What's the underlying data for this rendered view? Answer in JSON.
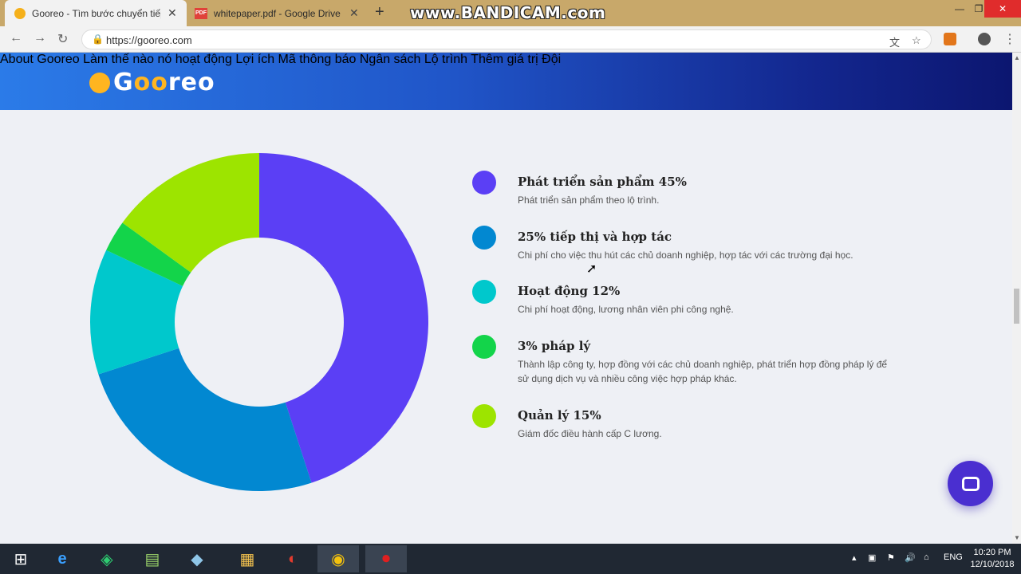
{
  "browser": {
    "tabs": [
      {
        "title": "Gooreo - Tìm bước chuyển tiếp t",
        "active": true
      },
      {
        "title": "whitepaper.pdf - Google Drive",
        "active": false
      }
    ],
    "new_tab_glyph": "+",
    "watermark": "www.BANDICAM.com",
    "url": "https://gooreo.com"
  },
  "site": {
    "logo_text": "Gooreo",
    "nav": [
      "About Gooreo",
      "Làm thế nào nó hoạt động",
      "Lợi ích",
      "Mã thông báo",
      "Ngân sách",
      "Lộ trình",
      "Thêm giá trị",
      "Đội"
    ]
  },
  "chart_data": {
    "type": "pie",
    "variant": "donut",
    "start": "top",
    "direction": "clockwise",
    "slices": [
      {
        "label": "Phát triển sản phẩm",
        "value": 45,
        "color": "#5b3ff5"
      },
      {
        "label": "Tiếp thị và hợp tác",
        "value": 25,
        "color": "#0288d1"
      },
      {
        "label": "Hoạt động",
        "value": 12,
        "color": "#00c8cc"
      },
      {
        "label": "Pháp lý",
        "value": 3,
        "color": "#13d44a"
      },
      {
        "label": "Quản lý",
        "value": 15,
        "color": "#9de400"
      }
    ]
  },
  "legend": [
    {
      "title": "Phát triển sản phẩm 45%",
      "desc": "Phát triển sản phẩm theo lộ trình.",
      "color": "#5b3ff5"
    },
    {
      "title": "25% tiếp thị và hợp tác",
      "desc": "Chi phí cho việc thu hút các chủ doanh nghiệp, hợp tác với các trường đại học.",
      "color": "#0288d1"
    },
    {
      "title": "Hoạt động 12%",
      "desc": "Chi phí hoạt động, lương nhân viên phi công nghệ.",
      "color": "#00c8cc"
    },
    {
      "title": "3% pháp lý",
      "desc": "Thành lập công ty, hợp đồng với các chủ doanh nghiệp, phát triển hợp đồng pháp lý để sử dụng dịch vụ và nhiều công việc hợp pháp khác.",
      "color": "#13d44a"
    },
    {
      "title": "Quản lý 15%",
      "desc": "Giám đốc điều hành cấp C lương.",
      "color": "#9de400"
    }
  ],
  "taskbar": {
    "language": "ENG",
    "time": "10:20 PM",
    "date": "12/10/2018"
  }
}
